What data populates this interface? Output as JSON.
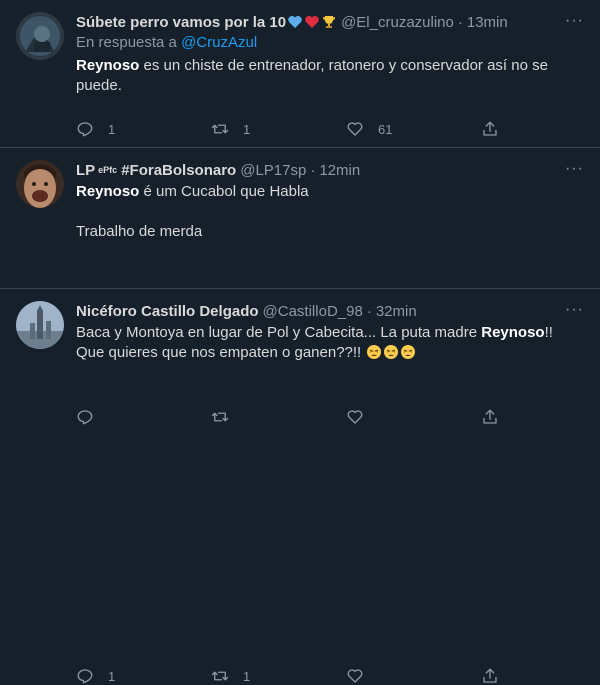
{
  "tweets": [
    {
      "name": "Súbete perro vamos por la 10",
      "handle": "@El_cruzazulino",
      "dot": "·",
      "time": "13min",
      "replying_prefix": "En respuesta a",
      "replying_to": "@CruzAzul",
      "bold_word": "Reynoso",
      "text": " es un chiste de entrenador, ratonero y conservador así no se puede.",
      "reply_count": "1",
      "retweet_count": "1",
      "like_count": "61",
      "name_emojis": [
        "blue-heart",
        "red-heart",
        "trophy"
      ]
    },
    {
      "name": "LP",
      "name_sup": "ePfc",
      "name_tag": "#ForaBolsonaro",
      "handle": "@LP17sp",
      "dot": "·",
      "time": "12min",
      "bold_word": "Reynoso",
      "text": " é um Cucabol que Habla",
      "text2": "Trabalho de merda",
      "reply_count": "",
      "retweet_count": "",
      "like_count": ""
    },
    {
      "name": "Nicéforo Castillo Delgado",
      "handle": "@CastilloD_98",
      "dot": "·",
      "time": "32min",
      "text_before": "Baca y Montoya en lugar de Pol y Cabecita... La puta madre ",
      "bold_word": "Reynoso",
      "text_after": "!! Que quieres que nos empaten o ganen??!! ",
      "reply_count": "1",
      "retweet_count": "1",
      "like_count": "",
      "text_emojis": [
        "tired-face",
        "tired-face",
        "tired-face"
      ]
    }
  ],
  "more_label": "···",
  "colors": {
    "background": "#15202b",
    "divider": "#38444d",
    "secondary": "#8b98a5",
    "link": "#1d9bf0"
  }
}
